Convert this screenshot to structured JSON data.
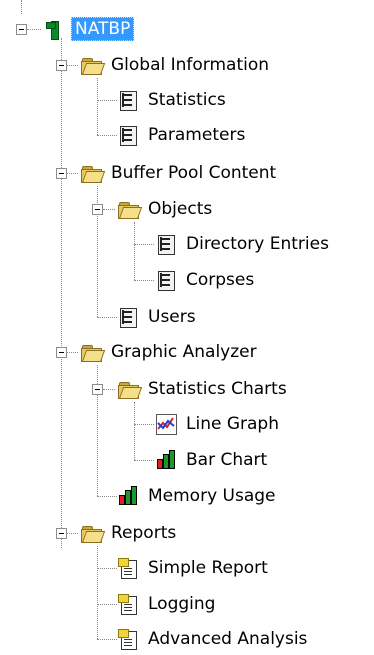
{
  "tree": {
    "root": {
      "label": "NATBP",
      "selected": true,
      "icon": "database-root-icon"
    },
    "global_information": {
      "label": "Global Information",
      "items": {
        "statistics": "Statistics",
        "parameters": "Parameters"
      }
    },
    "buffer_pool_content": {
      "label": "Buffer Pool Content",
      "objects": {
        "label": "Objects",
        "items": {
          "directory_entries": "Directory Entries",
          "corpses": "Corpses"
        }
      },
      "users": "Users"
    },
    "graphic_analyzer": {
      "label": "Graphic Analyzer",
      "statistics_charts": {
        "label": "Statistics Charts",
        "items": {
          "line_graph": "Line Graph",
          "bar_chart": "Bar Chart"
        }
      },
      "memory_usage": "Memory Usage"
    },
    "reports": {
      "label": "Reports",
      "items": {
        "simple_report": "Simple Report",
        "logging": "Logging",
        "advanced_analysis": "Advanced Analysis"
      }
    }
  },
  "colors": {
    "selection": "#3399ff",
    "folder": "#e7c95b",
    "root_icon": "#0b8a2a",
    "line_graph_red": "#e02020",
    "line_graph_blue": "#1f3fd0",
    "bar_red": "#e02020",
    "bar_green": "#1a9a2a"
  }
}
